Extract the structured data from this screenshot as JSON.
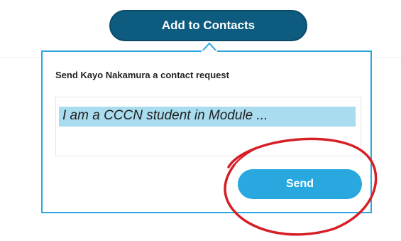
{
  "header": {
    "add_to_contacts_label": "Add to Contacts"
  },
  "request": {
    "prompt": "Send Kayo Nakamura a contact request",
    "message": "I am a CCCN student in Module ...",
    "send_label": "Send"
  },
  "colors": {
    "primary_dark": "#0d5c80",
    "accent": "#29a8e0",
    "selection_highlight": "#a9dcef",
    "annotation_red": "#d61f26"
  },
  "annotation": {
    "type": "hand-drawn-ellipse",
    "target": "send-button",
    "color": "#d61f26"
  }
}
